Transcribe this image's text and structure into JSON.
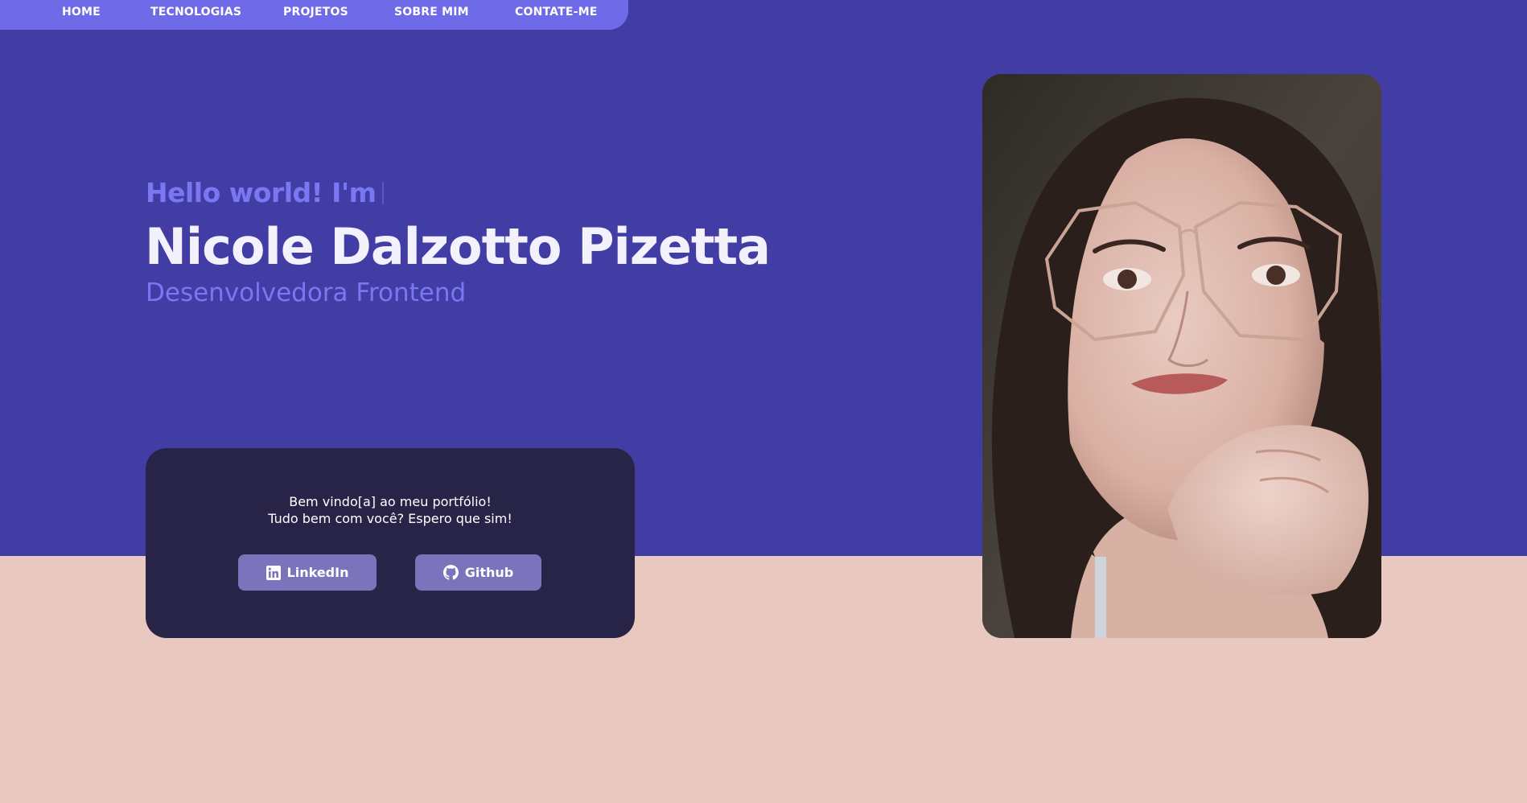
{
  "nav": {
    "items": [
      {
        "label": "HOME"
      },
      {
        "label": "TECNOLOGIAS"
      },
      {
        "label": "PROJETOS"
      },
      {
        "label": "SOBRE MIM"
      },
      {
        "label": "CONTATE-ME"
      }
    ]
  },
  "hero": {
    "greeting": "Hello world! I'm",
    "name": "Nicole Dalzotto Pizetta",
    "role": "Desenvolvedora Frontend"
  },
  "welcome": {
    "line1": "Bem vindo[a] ao meu portfólio!",
    "line2": "Tudo bem com você? Espero que sim!",
    "linkedin_label": "LinkedIn",
    "github_label": "Github"
  },
  "icons": {
    "linkedin": "linkedin-icon",
    "github": "github-icon"
  },
  "colors": {
    "hero_bg": "#413da4",
    "nav_bg": "#6e6ae8",
    "accent_text": "#7a77f2",
    "card_bg": "#282448",
    "button_bg": "#7b74bd",
    "page_bottom": "#e8c8bf"
  }
}
